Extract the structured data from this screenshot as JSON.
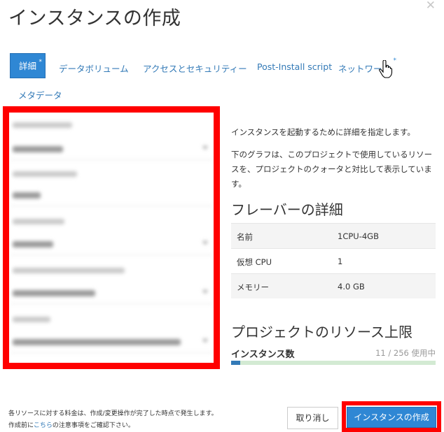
{
  "dialog": {
    "title": "インスタンスの作成"
  },
  "tabs": [
    {
      "label": "詳細",
      "required": true,
      "active": true
    },
    {
      "label": "データボリューム",
      "required": false
    },
    {
      "label": "アクセスとセキュリティー",
      "required": false
    },
    {
      "label": "Post-Install script",
      "required": false
    },
    {
      "label": "ネットワーク",
      "required": true
    },
    {
      "label": "メタデータ",
      "required": false
    }
  ],
  "required_marker": "*",
  "icons": {
    "close": "close-icon",
    "cursor": "hand-pointer-cursor",
    "caret": "caret-down-icon"
  },
  "help": {
    "p1": "インスタンスを起動するために詳細を指定します。",
    "p2": "下のグラフは、このプロジェクトで使用しているリソースを、プロジェクトのクォータと対比して表示しています。"
  },
  "flavor": {
    "heading": "フレーバーの詳細",
    "rows": [
      {
        "key": "名前",
        "value": "1CPU-4GB"
      },
      {
        "key": "仮想 CPU",
        "value": "1"
      },
      {
        "key": "メモリー",
        "value": "4.0 GB"
      }
    ]
  },
  "quota": {
    "heading": "プロジェクトのリソース上限",
    "label": "インスタンス数",
    "text": "11 / 256 使用中",
    "used": 11,
    "total": 256
  },
  "footer": {
    "line1": "各リソースに対する料金は、作成/変更操作が完了した時点で発生します。",
    "line2_pre": "作成前に",
    "line2_link": "こちら",
    "line2_post": "の注意事項をご確認下さい。"
  },
  "buttons": {
    "cancel": "取り消し",
    "create": "インスタンスの作成"
  },
  "colors": {
    "accent": "#2f87d4",
    "highlight": "#ff0000",
    "link": "#337ab7",
    "quota_bg": "#d3ead3"
  }
}
